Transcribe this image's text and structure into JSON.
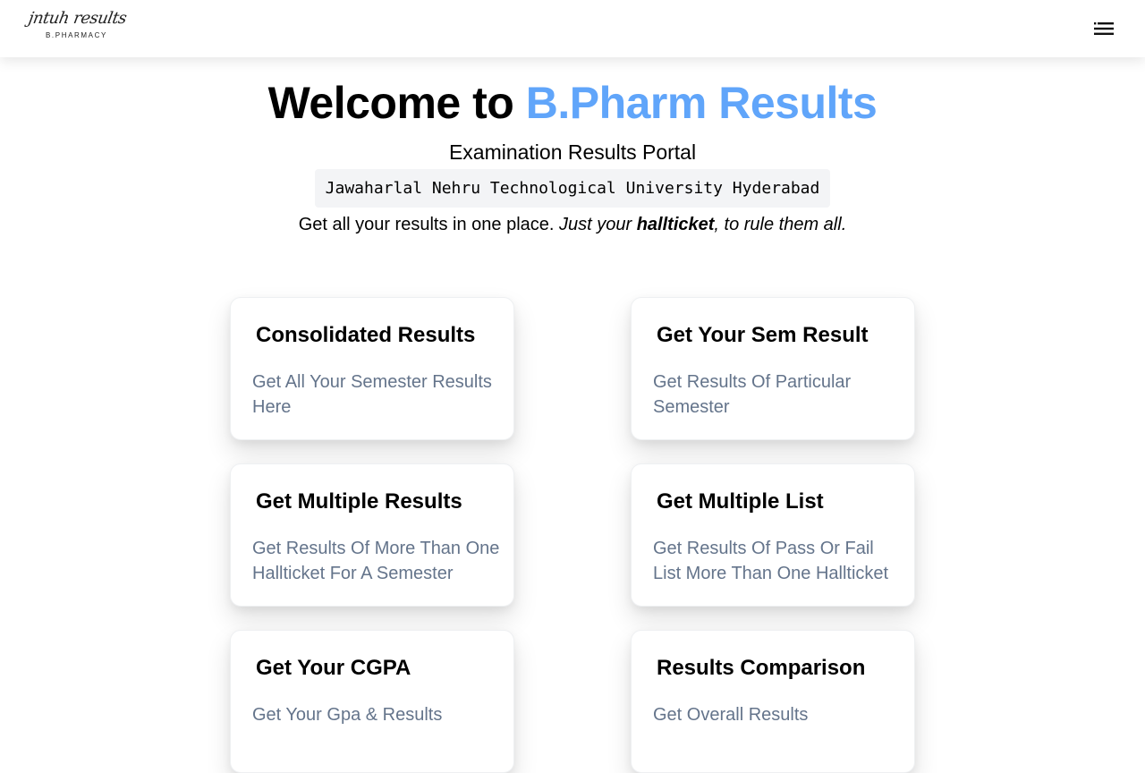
{
  "header": {
    "logo_script": "jntuh results",
    "logo_sub": "B.PHARMACY",
    "menu_icon": "hamburger-menu-icon"
  },
  "hero": {
    "title_prefix": "Welcome to ",
    "title_accent": "B.Pharm Results",
    "subtitle": "Examination Results Portal",
    "university": "Jawaharlal Nehru Technological University Hyderabad",
    "tagline_plain": "Get all your results in one place. ",
    "tagline_italic_1": "Just your ",
    "tagline_bold": "hallticket",
    "tagline_italic_2": ", to rule them all."
  },
  "cards": [
    {
      "title": "Consolidated Results",
      "description": "Get All Your Semester Results Here"
    },
    {
      "title": "Get Your Sem Result",
      "description": "Get Results Of Particular Semester"
    },
    {
      "title": "Get Multiple Results",
      "description": "Get Results Of More Than One Hallticket For A Semester"
    },
    {
      "title": "Get Multiple List",
      "description": "Get Results Of Pass Or Fail List More Than One Hallticket"
    },
    {
      "title": "Get Your CGPA",
      "description": "Get Your Gpa & Results"
    },
    {
      "title": "Results Comparison",
      "description": "Get Overall Results"
    }
  ],
  "colors": {
    "accent": "#60a5fa",
    "description_text": "#64748b",
    "code_background": "#f3f4f6"
  }
}
